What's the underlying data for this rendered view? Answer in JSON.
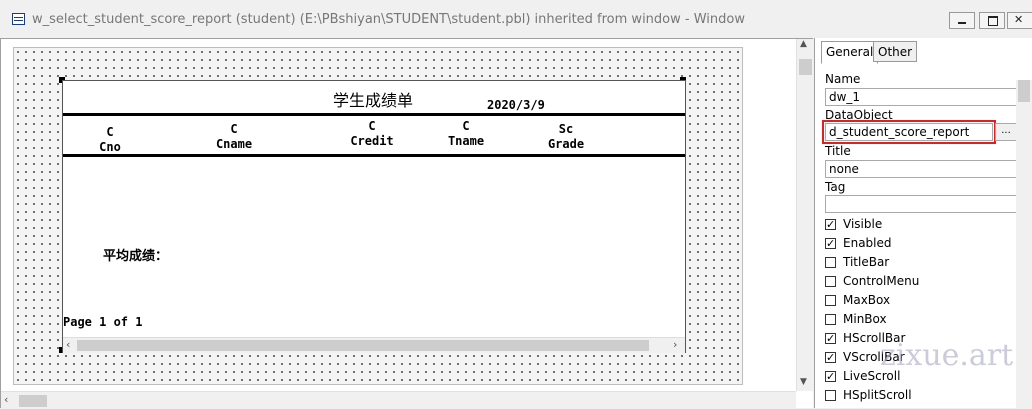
{
  "window": {
    "title": "w_select_student_score_report (student) (E:\\PBshiyan\\STUDENT\\student.pbl) inherited from window - Window"
  },
  "report": {
    "title": "学生成绩单",
    "date": "2020/3/9",
    "columns": [
      {
        "top": "C",
        "bottom": "Cno"
      },
      {
        "top": "C",
        "bottom": "Cname"
      },
      {
        "top": "C",
        "bottom": "Credit"
      },
      {
        "top": "C",
        "bottom": "Tname"
      },
      {
        "top": "Sc",
        "bottom": "Grade"
      }
    ],
    "average_label": "平均成绩：",
    "page_label": "Page 1 of 1"
  },
  "properties": {
    "tabs": [
      "General",
      "Other"
    ],
    "active_tab": "General",
    "name_label": "Name",
    "name_value": "dw_1",
    "dataobject_label": "DataObject",
    "dataobject_value": "d_student_score_report",
    "dataobject_button": "...",
    "title_label": "Title",
    "title_value": "none",
    "tag_label": "Tag",
    "tag_value": "",
    "checkboxes": [
      {
        "label": "Visible",
        "checked": true
      },
      {
        "label": "Enabled",
        "checked": true
      },
      {
        "label": "TitleBar",
        "checked": false
      },
      {
        "label": "ControlMenu",
        "checked": false
      },
      {
        "label": "MaxBox",
        "checked": false
      },
      {
        "label": "MinBox",
        "checked": false
      },
      {
        "label": "HScrollBar",
        "checked": true
      },
      {
        "label": "VScrollBar",
        "checked": true
      },
      {
        "label": "LiveScroll",
        "checked": true
      },
      {
        "label": "HSplitScroll",
        "checked": false
      }
    ]
  },
  "watermark": "zixue.art",
  "colors": {
    "highlight_border": "#e02020",
    "panel_bg": "#f0f0f0"
  }
}
